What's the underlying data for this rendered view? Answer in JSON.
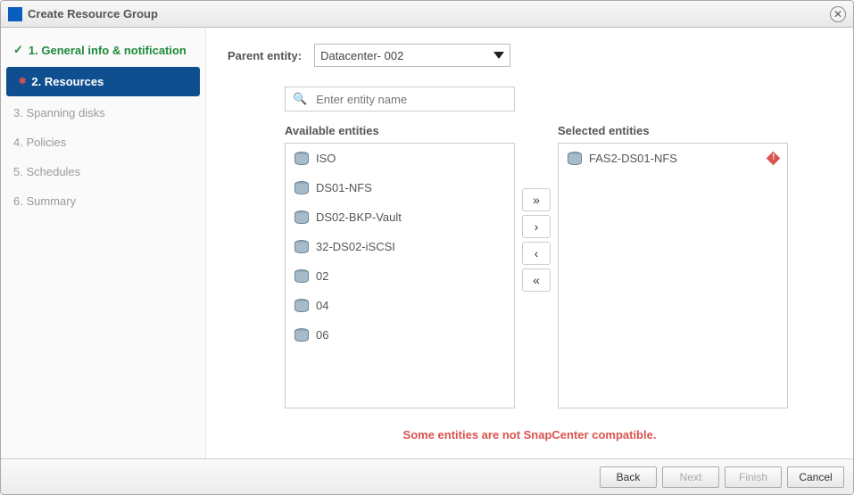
{
  "window": {
    "title": "Create Resource Group"
  },
  "steps": {
    "s1": "1. General info & notification",
    "s2": "2. Resources",
    "s3": "3. Spanning disks",
    "s4": "4. Policies",
    "s5": "5. Schedules",
    "s6": "6. Summary"
  },
  "form": {
    "parent_entity_label": "Parent entity:",
    "parent_entity_value": "Datacenter-    002",
    "search_placeholder": "Enter entity name",
    "available_header": "Available entities",
    "selected_header": "Selected entities"
  },
  "available": {
    "e0": "ISO",
    "e1": "DS01-NFS",
    "e2": "DS02-BKP-Vault",
    "e3": "32-DS02-iSCSI",
    "e4": "02",
    "e5": "04",
    "e6": "06"
  },
  "selected": {
    "e0": "FAS2-DS01-NFS"
  },
  "warning": "Some entities are not SnapCenter compatible.",
  "buttons": {
    "back": "Back",
    "next": "Next",
    "finish": "Finish",
    "cancel": "Cancel"
  }
}
